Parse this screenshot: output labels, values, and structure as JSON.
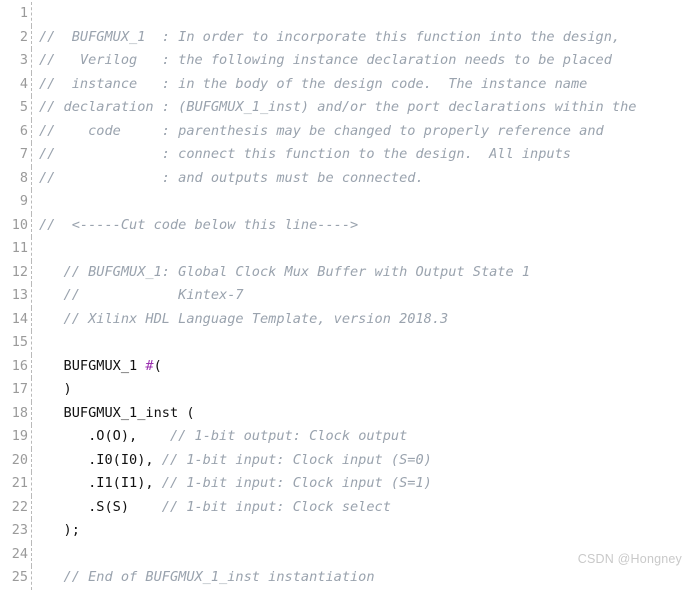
{
  "editor": {
    "language": "verilog",
    "gutter_color": "#9a9a9a",
    "comment_color": "#9aa3ae",
    "code_color": "#111111",
    "operator_color": "#9b30b0",
    "background_color": "#ffffff",
    "first_line": 1,
    "last_line": 25,
    "lines": [
      {
        "number": "1",
        "text": "",
        "kind": "blank"
      },
      {
        "number": "2",
        "text": "//  BUFGMUX_1  : In order to incorporate this function into the design,",
        "kind": "comment"
      },
      {
        "number": "3",
        "text": "//   Verilog   : the following instance declaration needs to be placed",
        "kind": "comment"
      },
      {
        "number": "4",
        "text": "//  instance   : in the body of the design code.  The instance name",
        "kind": "comment"
      },
      {
        "number": "5",
        "text": "// declaration : (BUFGMUX_1_inst) and/or the port declarations within the",
        "kind": "comment"
      },
      {
        "number": "6",
        "text": "//    code     : parenthesis may be changed to properly reference and",
        "kind": "comment"
      },
      {
        "number": "7",
        "text": "//             : connect this function to the design.  All inputs",
        "kind": "comment"
      },
      {
        "number": "8",
        "text": "//             : and outputs must be connected.",
        "kind": "comment"
      },
      {
        "number": "9",
        "text": "",
        "kind": "blank"
      },
      {
        "number": "10",
        "text": "//  <-----Cut code below this line---->",
        "kind": "comment"
      },
      {
        "number": "11",
        "text": "",
        "kind": "blank"
      },
      {
        "number": "12",
        "text": "   // BUFGMUX_1: Global Clock Mux Buffer with Output State 1",
        "kind": "comment"
      },
      {
        "number": "13",
        "text": "   //            Kintex-7",
        "kind": "comment"
      },
      {
        "number": "14",
        "text": "   // Xilinx HDL Language Template, version 2018.3",
        "kind": "comment"
      },
      {
        "number": "15",
        "text": "",
        "kind": "blank"
      },
      {
        "number": "16",
        "kind": "mixed",
        "spans": [
          {
            "text": "   BUFGMUX_1 ",
            "kind": "code"
          },
          {
            "text": "#",
            "kind": "operator"
          },
          {
            "text": "(",
            "kind": "code"
          }
        ]
      },
      {
        "number": "17",
        "text": "   )",
        "kind": "code"
      },
      {
        "number": "18",
        "text": "   BUFGMUX_1_inst (",
        "kind": "code"
      },
      {
        "number": "19",
        "kind": "mixed",
        "spans": [
          {
            "text": "      .O(O),    ",
            "kind": "code"
          },
          {
            "text": "// 1-bit output: Clock output",
            "kind": "comment"
          }
        ]
      },
      {
        "number": "20",
        "kind": "mixed",
        "spans": [
          {
            "text": "      .I0(I0), ",
            "kind": "code"
          },
          {
            "text": "// 1-bit input: Clock input (S=0)",
            "kind": "comment"
          }
        ]
      },
      {
        "number": "21",
        "kind": "mixed",
        "spans": [
          {
            "text": "      .I1(I1), ",
            "kind": "code"
          },
          {
            "text": "// 1-bit input: Clock input (S=1)",
            "kind": "comment"
          }
        ]
      },
      {
        "number": "22",
        "kind": "mixed",
        "spans": [
          {
            "text": "      .S(S)    ",
            "kind": "code"
          },
          {
            "text": "// 1-bit input: Clock select",
            "kind": "comment"
          }
        ]
      },
      {
        "number": "23",
        "text": "   );",
        "kind": "code"
      },
      {
        "number": "24",
        "text": "",
        "kind": "blank"
      },
      {
        "number": "25",
        "text": "   // End of BUFGMUX_1_inst instantiation",
        "kind": "comment"
      }
    ]
  },
  "watermark": {
    "text": "CSDN @Hongney"
  }
}
